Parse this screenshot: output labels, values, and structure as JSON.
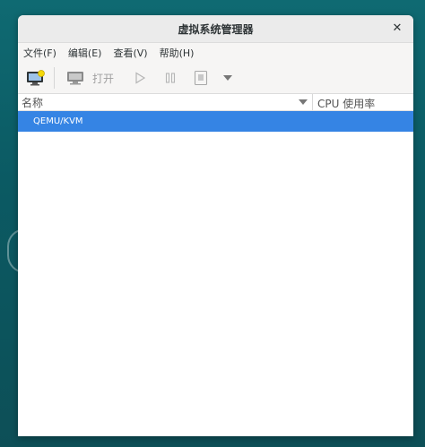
{
  "window": {
    "title": "虚拟系统管理器"
  },
  "menubar": {
    "items": [
      "文件(F)",
      "编辑(E)",
      "查看(V)",
      "帮助(H)"
    ]
  },
  "toolbar": {
    "open_label": "打开"
  },
  "columns": {
    "name": "名称",
    "cpu": "CPU 使用率"
  },
  "connections": [
    {
      "name": "QEMU/KVM",
      "selected": true
    }
  ],
  "colors": {
    "selection": "#3584e4",
    "desktop": "#0f6a72"
  }
}
